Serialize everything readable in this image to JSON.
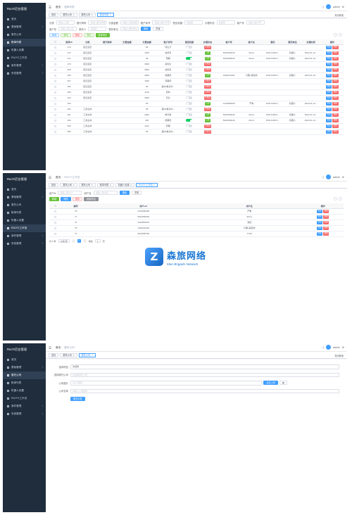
{
  "frame1": {
    "sidebar": {
      "logo": "RuoYi后台管理",
      "items": [
        {
          "label": "首页",
          "active": false,
          "chev": false
        },
        {
          "label": "基础管理",
          "active": false,
          "chev": true
        },
        {
          "label": "委托公司",
          "active": false,
          "chev": false
        },
        {
          "label": "账单列表",
          "active": true,
          "chev": false
        },
        {
          "label": "机器人设置",
          "active": false,
          "chev": false
        },
        {
          "label": "RUOYI工作流",
          "active": false,
          "chev": false
        },
        {
          "label": "案件管理",
          "active": false,
          "chev": true
        },
        {
          "label": "系统管理",
          "active": false,
          "chev": true
        }
      ]
    },
    "navbar": {
      "crumb_home": "首页",
      "crumb_current": "账单列表",
      "user": "admin"
    },
    "tags": [
      {
        "label": "首页",
        "on": false,
        "close": false
      },
      {
        "label": "委托公司",
        "on": false,
        "close": true
      },
      {
        "label": "委托公司",
        "on": false,
        "close": true
      },
      {
        "label": "账单列表",
        "on": true,
        "close": true
      }
    ],
    "tags_right": "关闭其他",
    "search_rows": [
      [
        {
          "label": "分类",
          "placeholder": "请输入分类"
        },
        {
          "label": "银行简称",
          "placeholder": "请输入银行简称"
        },
        {
          "label": "欠费金额",
          "placeholder": "请输入欠费金额"
        },
        {
          "label": "账户序号",
          "placeholder": "请输入账户序号"
        },
        {
          "label": "是否机器",
          "placeholder": "请选择"
        },
        {
          "label": "办理状态",
          "placeholder": "请选择"
        },
        {
          "label": "客户号",
          "placeholder": "请输入客户号"
        }
      ],
      [
        {
          "label": "客户名",
          "placeholder": "请输入客户名"
        },
        {
          "label": "委托人",
          "placeholder": "请选择"
        },
        {
          "label": "委托单位",
          "placeholder": "请输入委托单位"
        }
      ]
    ],
    "search_btn": "搜索",
    "reset_btn": "重置",
    "toolbar": [
      "新增",
      "修改",
      "删除",
      "导出",
      "批量导出"
    ],
    "columns": [
      "",
      "账号ID",
      "分类",
      "银行简称",
      "欠费金额",
      "欠费金额",
      "账户序号",
      "是否机器",
      "办理状态",
      "客户号",
      "客户名",
      "委托",
      "委托单位",
      "办理时间",
      "操作"
    ],
    "rows": [
      {
        "id": "273",
        "cat": "拒还且走",
        "amt": "95",
        "seq": "同比分",
        "sw": false,
        "st": "待处理",
        "stc": "r",
        "cust": "",
        "name": "",
        "phone": "",
        "unit": "",
        "time": ""
      },
      {
        "id": "272",
        "cat": "拒还且走",
        "amt": "1900",
        "seq": "充值款",
        "sw": false,
        "st": "已办",
        "stc": "g",
        "cust": "5024069049",
        "name": "dbxxx",
        "phone": "1591723971...",
        "unit": "机器人",
        "time": "2022-01-12..."
      },
      {
        "id": "271",
        "cat": "拒还且走",
        "amt": "36",
        "seq": "预期",
        "sw": true,
        "st": "已办",
        "stc": "g",
        "cust": "5024069049",
        "name": "dbxxx",
        "phone": "1591723971...",
        "unit": "机器人",
        "time": "2022-01-12..."
      },
      {
        "id": "270",
        "cat": "拒还且走",
        "amt": "3900",
        "seq": "资料比",
        "sw": false,
        "st": "待处理",
        "stc": "r",
        "cust": "",
        "name": "",
        "phone": "",
        "unit": "",
        "time": ""
      },
      {
        "id": "269",
        "cat": "拒还且走",
        "amt": "2800",
        "seq": "资料待",
        "sw": false,
        "st": "待处理",
        "stc": "r",
        "cust": "",
        "name": "",
        "phone": "",
        "unit": "",
        "time": ""
      },
      {
        "id": "268",
        "cat": "拒还且走",
        "amt": "2800",
        "seq": "前期值",
        "sw": false,
        "st": "已办",
        "stc": "g",
        "cust": "1962210493",
        "name": "分期+其他款",
        "phone": "1591723971...",
        "unit": "机器人",
        "time": "2022-01-12..."
      },
      {
        "id": "267",
        "cat": "拒还且走",
        "amt": "1900",
        "seq": "同期待",
        "sw": false,
        "st": "待处理",
        "stc": "r",
        "cust": "",
        "name": "",
        "phone": "",
        "unit": "",
        "time": ""
      },
      {
        "id": "266",
        "cat": "拒还且走",
        "amt": "95",
        "seq": "其中(重点中...",
        "sw": false,
        "st": "待处理",
        "stc": "r",
        "cust": "",
        "name": "",
        "phone": "",
        "unit": "",
        "time": ""
      },
      {
        "id": "265",
        "cat": "拒还且走",
        "amt": "1120",
        "seq": "原料",
        "sw": false,
        "st": "待处理",
        "stc": "r",
        "cust": "",
        "name": "",
        "phone": "",
        "unit": "",
        "time": ""
      },
      {
        "id": "264",
        "cat": "拒还且走",
        "amt": "2800",
        "seq": "同比",
        "sw": false,
        "st": "待处理",
        "stc": "r",
        "cust": "",
        "name": "",
        "phone": "",
        "unit": "",
        "time": ""
      },
      {
        "id": "263",
        "cat": "",
        "amt": "95",
        "seq": "",
        "sw": false,
        "st": "已办",
        "stc": "g",
        "cust": "2123590608",
        "name": "严重",
        "phone": "1591723971...",
        "unit": "机器人",
        "time": "2022-01-12..."
      },
      {
        "id": "262",
        "cat": "工商主体",
        "amt": "95",
        "seq": "其中(重点中...",
        "sw": false,
        "st": "待处理",
        "stc": "r",
        "cust": "",
        "name": "",
        "phone": "",
        "unit": "",
        "time": ""
      },
      {
        "id": "261",
        "cat": "工商主体",
        "amt": "2900",
        "seq": "单日量",
        "sw": false,
        "st": "已办",
        "stc": "g",
        "cust": "5024069049",
        "name": "dbxxx",
        "phone": "1591723971...",
        "unit": "机器人",
        "time": "2022-01-12..."
      },
      {
        "id": "260",
        "cat": "工商主体",
        "amt": "335",
        "seq": "增期值",
        "sw": true,
        "st": "已办",
        "stc": "g",
        "cust": "5024069049",
        "name": "dbxxx",
        "phone": "1591723971...",
        "unit": "机器人",
        "time": "2022-01-12..."
      },
      {
        "id": "259",
        "cat": "工商主体",
        "amt": "1120",
        "seq": "原期",
        "sw": false,
        "st": "待处理",
        "stc": "r",
        "cust": "",
        "name": "",
        "phone": "",
        "unit": "",
        "time": ""
      },
      {
        "id": "258",
        "cat": "工商主体",
        "amt": "95",
        "seq": "其中(重点中...",
        "sw": false,
        "st": "待处理",
        "stc": "r",
        "cust": "",
        "name": "",
        "phone": "",
        "unit": "",
        "time": ""
      }
    ],
    "op_edit": "修改",
    "op_delete": "删除"
  },
  "frame2": {
    "sidebar": {
      "items": [
        {
          "label": "首页",
          "active": false,
          "chev": false
        },
        {
          "label": "基础管理",
          "active": false,
          "chev": true
        },
        {
          "label": "委托公司",
          "active": false,
          "chev": false
        },
        {
          "label": "账单列表",
          "active": false,
          "chev": false
        },
        {
          "label": "机器人设置",
          "active": false,
          "chev": false
        },
        {
          "label": "RUOYI工作流",
          "active": true,
          "chev": false
        },
        {
          "label": "案件管理",
          "active": false,
          "chev": true
        },
        {
          "label": "系统管理",
          "active": false,
          "chev": true
        }
      ]
    },
    "navbar": {
      "crumb_home": "首页",
      "crumb_current": "RUOYI工作流"
    },
    "tags": [
      {
        "label": "首页",
        "on": false,
        "close": false
      },
      {
        "label": "委托公司",
        "on": false,
        "close": true
      },
      {
        "label": "委托公司",
        "on": false,
        "close": true
      },
      {
        "label": "账单列表",
        "on": false,
        "close": true
      },
      {
        "label": "机器人设置",
        "on": false,
        "close": true
      },
      {
        "label": "RUOYI工作流",
        "on": true,
        "close": true
      }
    ],
    "search": [
      {
        "label": "用户id",
        "placeholder": "请输入用户id"
      },
      {
        "label": "用户名",
        "placeholder": "请输入用户名"
      }
    ],
    "toolbar": [
      "新增",
      "修改",
      "删除",
      "批量导出"
    ],
    "columns": [
      "",
      "编号",
      "用户uid",
      "用户名",
      "操作"
    ],
    "rows": [
      {
        "id": "78",
        "uid": "2123590608",
        "name": "严重"
      },
      {
        "id": "77",
        "uid": "5024069049",
        "name": "dbxxx"
      },
      {
        "id": "76",
        "uid": "1242852575",
        "name": "测控"
      },
      {
        "id": "75",
        "uid": "1962210493",
        "name": "分期+其他款"
      },
      {
        "id": "74",
        "uid": "5021808700",
        "name": "773/2"
      }
    ],
    "pagination": {
      "total": "共 5 条",
      "size": "10条/页",
      "current": "1",
      "goto": "前往",
      "page": "1",
      "unit": "页"
    }
  },
  "frame3": {
    "sidebar": {
      "items": [
        {
          "label": "首页",
          "active": false,
          "chev": false
        },
        {
          "label": "基础管理",
          "active": false,
          "chev": true
        },
        {
          "label": "委托公司",
          "active": true,
          "chev": false
        },
        {
          "label": "账单列表",
          "active": false,
          "chev": false
        },
        {
          "label": "机器人设置",
          "active": false,
          "chev": false
        },
        {
          "label": "RUOYI工作流",
          "active": false,
          "chev": false
        },
        {
          "label": "案件管理",
          "active": false,
          "chev": true
        },
        {
          "label": "系统管理",
          "active": false,
          "chev": true
        }
      ]
    },
    "navbar": {
      "crumb_home": "首页",
      "crumb_current": "委托公司"
    },
    "tags": [
      {
        "label": "首页",
        "on": false,
        "close": false
      },
      {
        "label": "委托公司",
        "on": false,
        "close": true
      },
      {
        "label": "委托公司",
        "on": true,
        "close": true
      }
    ],
    "form": [
      {
        "label": "选择项目",
        "value": "请选择",
        "dark": true
      },
      {
        "label": "选择委托公司",
        "value": "请选择委托公司",
        "dark": false
      },
      {
        "label": "公司图片",
        "value": "请上传图片",
        "dark": false
      },
      {
        "label": "公司名称",
        "value": "请输入公司名称",
        "dark": false
      }
    ],
    "upload_btn": "点击上传",
    "submit_btn": "提交分发"
  },
  "watermark": {
    "logo_char": "Z",
    "title": "森旅网络",
    "subtitle": "Man Brigade Network"
  },
  "colors": {
    "sidebar": "#1f2d3d",
    "primary": "#409eff",
    "success": "#67c23a",
    "danger": "#f56c6c"
  }
}
